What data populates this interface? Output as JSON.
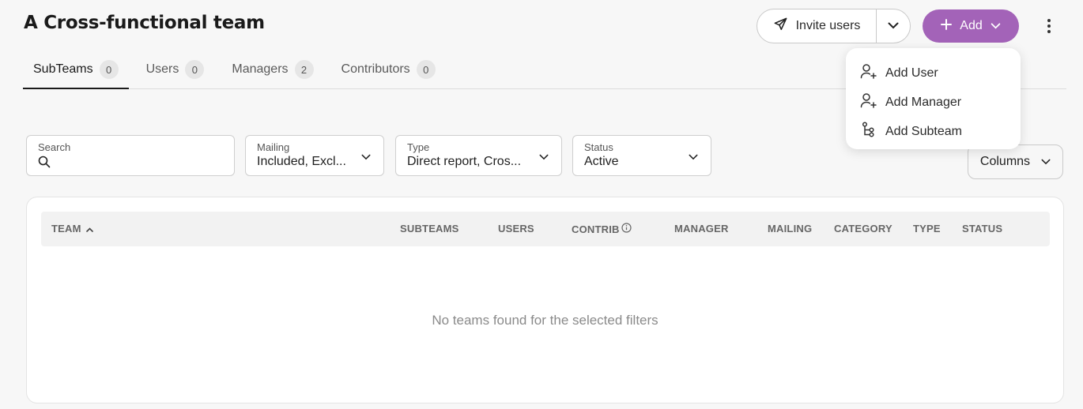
{
  "page": {
    "title": "A Cross-functional team"
  },
  "header": {
    "invite_label": "Invite users",
    "add_label": "Add",
    "accent_color": "#a363b8"
  },
  "tabs": [
    {
      "label": "SubTeams",
      "count": "0",
      "active": true
    },
    {
      "label": "Users",
      "count": "0",
      "active": false
    },
    {
      "label": "Managers",
      "count": "2",
      "active": false
    },
    {
      "label": "Contributors",
      "count": "0",
      "active": false
    }
  ],
  "filters": {
    "search": {
      "label": "Search",
      "value": ""
    },
    "mailing": {
      "label": "Mailing",
      "value": "Included, Excl..."
    },
    "type": {
      "label": "Type",
      "value": "Direct report, Cros..."
    },
    "status": {
      "label": "Status",
      "value": "Active"
    }
  },
  "columns_label": "Columns",
  "table": {
    "headers": [
      "TEAM",
      "SUBTEAMS",
      "USERS",
      "CONTRIB",
      "MANAGER",
      "MAILING",
      "CATEGORY",
      "TYPE",
      "STATUS"
    ],
    "empty_message": "No teams found for the selected filters"
  },
  "add_menu": {
    "items": [
      {
        "label": "Add User",
        "icon": "user-plus-icon"
      },
      {
        "label": "Add Manager",
        "icon": "user-plus-icon"
      },
      {
        "label": "Add Subteam",
        "icon": "subteam-icon"
      }
    ]
  }
}
